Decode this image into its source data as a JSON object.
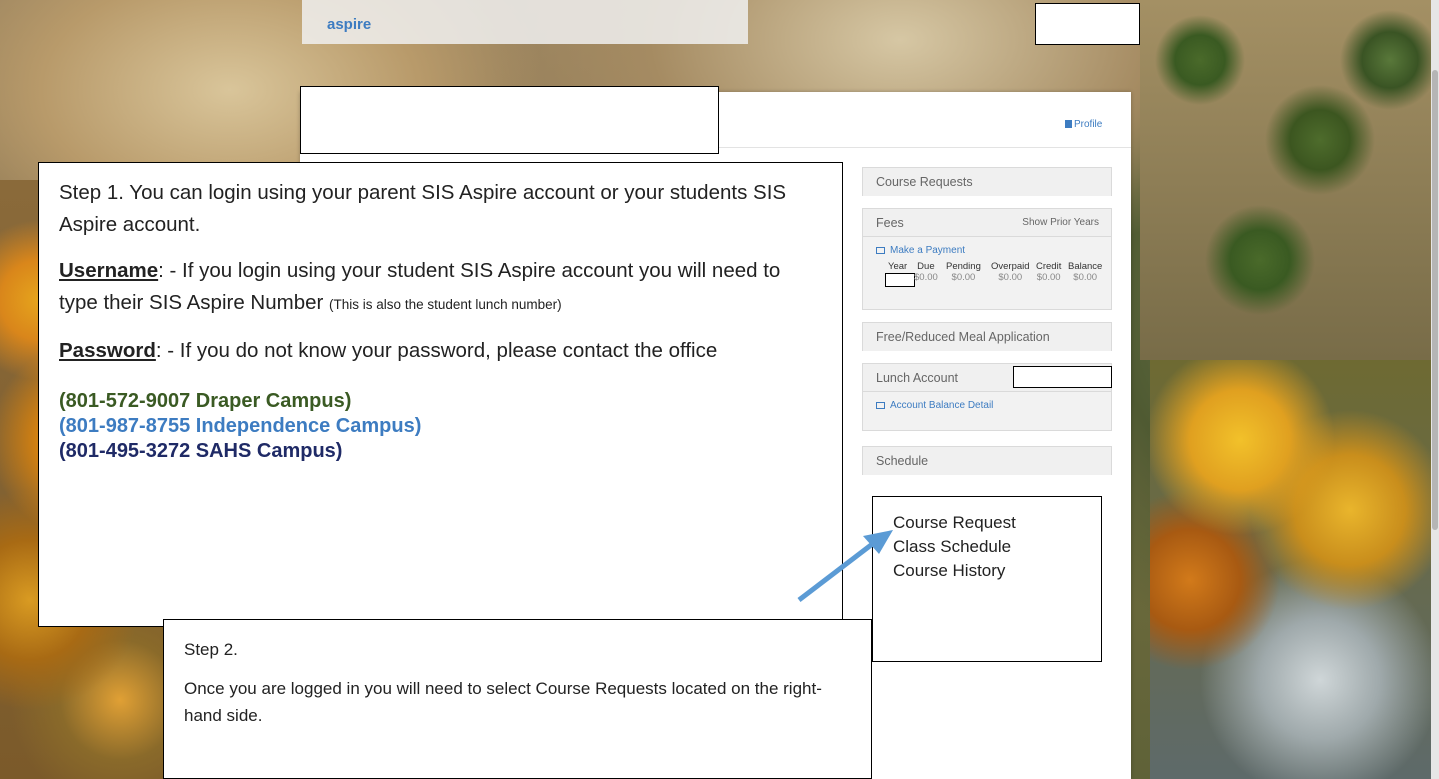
{
  "header": {
    "brand": "aspire"
  },
  "panel": {
    "profile_label": "Profile"
  },
  "sidebar": {
    "course_requests": "Course Requests",
    "fees": {
      "title": "Fees",
      "show_prior": "Show Prior Years",
      "make_payment": "Make a Payment",
      "columns": [
        {
          "header": "Year",
          "value": ""
        },
        {
          "header": "Due",
          "value": "$0.00"
        },
        {
          "header": "Pending",
          "value": "$0.00"
        },
        {
          "header": "Overpaid",
          "value": "$0.00"
        },
        {
          "header": "Credit",
          "value": "$0.00"
        },
        {
          "header": "Balance",
          "value": "$0.00"
        }
      ]
    },
    "meal_application": "Free/Reduced Meal Application",
    "lunch": {
      "title": "Lunch Account",
      "balance_detail": "Account Balance Detail"
    },
    "schedule": "Schedule"
  },
  "step1": {
    "intro": "Step 1. You can login using your parent SIS Aspire account or your students SIS Aspire account.",
    "username_label": "Username",
    "username_text": ": - If you login using your student SIS Aspire account you will need to type their SIS Aspire Number",
    "username_note": "(This is also the student lunch number)",
    "password_label": "Password",
    "password_text": ": - If you do not know your password, please contact the office",
    "phones": [
      {
        "text": "(801-572-9007 Draper Campus)",
        "color": "#3a5a23"
      },
      {
        "text": "(801-987-8755 Independence Campus)",
        "color": "#3d7cc1"
      },
      {
        "text": "(801-495-3272 SAHS Campus)",
        "color": "#1f2a66"
      }
    ]
  },
  "step2": {
    "title": "Step 2.",
    "text": "Once you are logged in you will need to select Course Requests located on the right-hand side."
  },
  "menu_note": {
    "items": [
      "Course Request",
      "Class Schedule",
      "Course History"
    ]
  },
  "colors": {
    "link_blue": "#3d7cc1",
    "arrow_blue": "#5b9bd5"
  }
}
